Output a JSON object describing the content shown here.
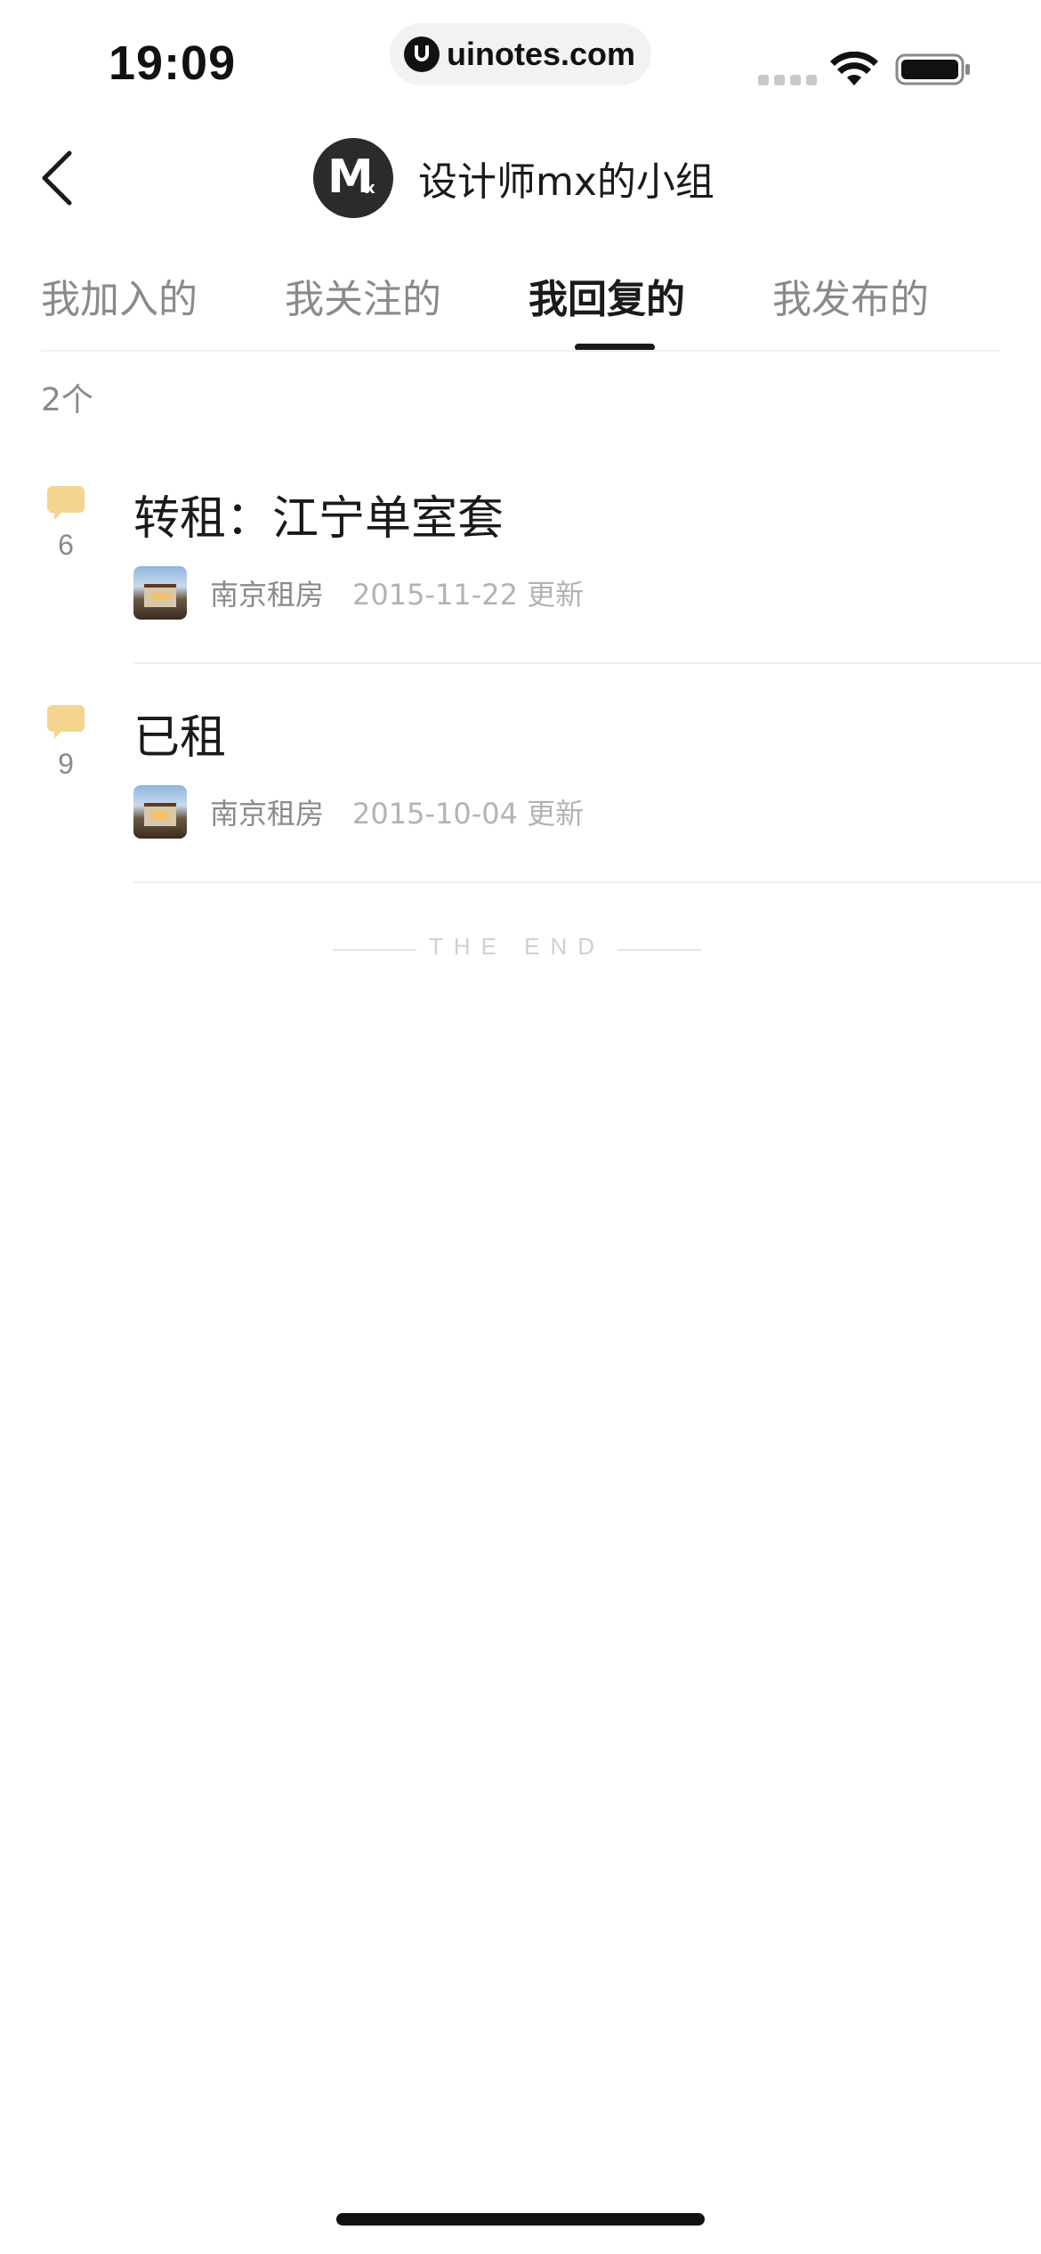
{
  "status_bar": {
    "time": "19:09",
    "url": "uinotes.com"
  },
  "header": {
    "title": "设计师mx的小组",
    "avatar_letter": "M",
    "avatar_sub": "x"
  },
  "tabs": [
    {
      "label": "我加入的",
      "active": false
    },
    {
      "label": "我关注的",
      "active": false
    },
    {
      "label": "我回复的",
      "active": true
    },
    {
      "label": "我发布的",
      "active": false
    }
  ],
  "count_label": "2个",
  "items": [
    {
      "title": "转租：江宁单室套",
      "comments": "6",
      "group": "南京租房",
      "date": "2015-11-22 更新"
    },
    {
      "title": "已租",
      "comments": "9",
      "group": "南京租房",
      "date": "2015-10-04 更新"
    }
  ],
  "end_text": "THE END",
  "colors": {
    "accent_comment": "#f3d58f",
    "text_primary": "#1a1a1a",
    "text_secondary": "#8a8a8a",
    "text_tertiary": "#b3b3b3"
  },
  "icons": {
    "back": "chevron-left-icon",
    "comment": "speech-bubble-icon",
    "wifi": "wifi-icon",
    "battery": "battery-icon"
  }
}
